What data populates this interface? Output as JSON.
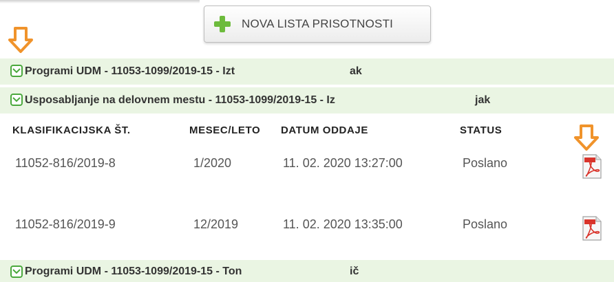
{
  "toolbar": {
    "new_list_label": "NOVA LISTA PRISOTNOSTI"
  },
  "groups": [
    {
      "label": "Programi UDM - 11053-1099/2019-15 - Izt",
      "suffix": "ak"
    },
    {
      "label": "Usposabljanje na delovnem mestu - 11053-1099/2019-15 - Iz",
      "suffix": "jak"
    },
    {
      "label": "Programi UDM - 11053-1099/2019-15 - Ton",
      "suffix": "ič"
    }
  ],
  "table": {
    "headers": {
      "klasifikacija": "KLASIFIKACIJSKA ŠT.",
      "mesec": "MESEC/LETO",
      "datum": "DATUM ODDAJE",
      "status": "STATUS"
    },
    "rows": [
      {
        "klasifikacija": "11052-816/2019-8",
        "mesec": "1/2020",
        "datum": "11. 02. 2020 13:27:00",
        "status": "Poslano"
      },
      {
        "klasifikacija": "11052-816/2019-9",
        "mesec": "12/2019",
        "datum": "11. 02. 2020 13:35:00",
        "status": "Poslano"
      }
    ]
  },
  "icons": {
    "plus": "plus-icon",
    "arrow": "arrow-down-icon",
    "chevron": "chevron-down-icon",
    "pdf": "pdf-icon"
  },
  "colors": {
    "group_bg": "#eaf5e3",
    "accent_green": "#4aa83c",
    "arrow_orange": "#f0932b",
    "pdf_red": "#d9342b"
  }
}
